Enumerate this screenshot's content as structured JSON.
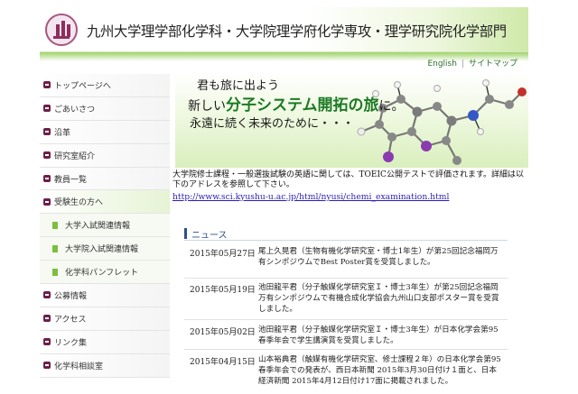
{
  "header": {
    "title": "九州大学理学部化学科・大学院理学府化学専攻・理学研究院化学部門"
  },
  "top_links": {
    "english": "English",
    "separator": "|",
    "sitemap": "サイトマップ"
  },
  "sidebar": {
    "items": [
      {
        "label": "トップページへ"
      },
      {
        "label": "ごあいさつ"
      },
      {
        "label": "沿革"
      },
      {
        "label": "研究室紹介"
      },
      {
        "label": "教員一覧"
      },
      {
        "label": "受験生の方へ"
      },
      {
        "label": "大学入試関連情報"
      },
      {
        "label": "大学院入試関連情報"
      },
      {
        "label": "化学科パンフレット"
      },
      {
        "label": "公募情報"
      },
      {
        "label": "アクセス"
      },
      {
        "label": "リンク集"
      },
      {
        "label": "化学科相談室"
      }
    ]
  },
  "banner": {
    "line1": "君も旅に出よう",
    "line2_prefix": "新しい",
    "line2_highlight": "分子システム開拓の旅",
    "line2_suffix": "に。",
    "line3": "永遠に続く未来のために・・・"
  },
  "notice": {
    "text": "大学院修士課程・一般選抜試験の英語に関しては、TOEIC公開テストで評価されます。詳細は以下のアドレスを参照して下さい。",
    "link": "http://www.sci.kyushu-u.ac.jp/html/nyusi/chemi_examination.html"
  },
  "news": {
    "heading": "ニュース",
    "items": [
      {
        "date": "2015年05月27日",
        "text": "尾上久晃君（生物有機化学研究室・博士1年生）が第25回記念福岡万有シンポジウムでBest Poster賞を受賞しました。"
      },
      {
        "date": "2015年05月19日",
        "text": "池田龍平君（分子触媒化学研究室Ｉ・博士3年生）が第25回記念福岡万有シンポジウムで有機合成化学協会九州山口支部ポスター賞を受賞しました。"
      },
      {
        "date": "2015年05月02日",
        "text": "池田龍平君（分子触媒化学研究室Ｉ・博士3年生）が日本化学会第95春季年会で学生講演賞を受賞しました。"
      },
      {
        "date": "2015年04月15日",
        "text": "山本裕典君（触媒有機化学研究室、修士課程２年）の日本化学会第95春季年会での発表が、西日本新聞 2015年3月30日付け１面と、日本経済新聞 2015年4月12日付け17面に掲載されました。"
      }
    ]
  },
  "colors": {
    "accent_green": "#7bbf3e",
    "menu_bullet": "#6c1f4a",
    "news_heading": "#2e4f8c",
    "link": "#2a1fb5",
    "banner_highlight": "#1b7a22"
  }
}
